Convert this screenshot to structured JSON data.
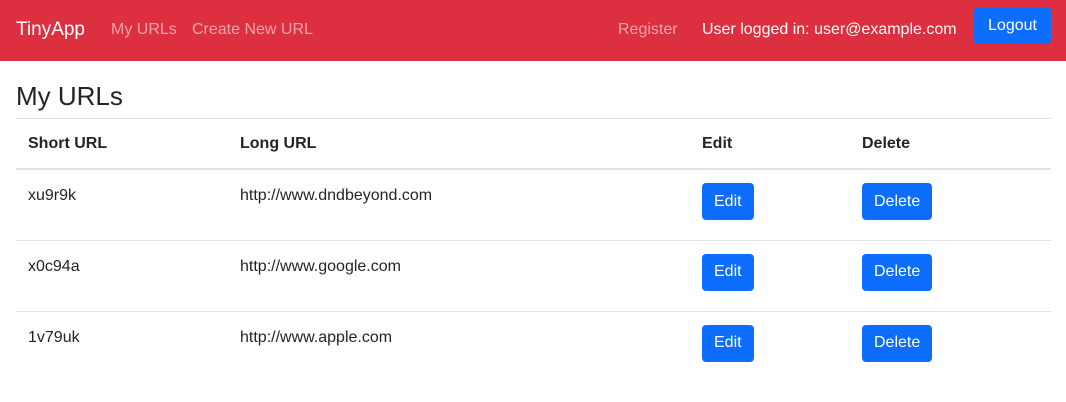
{
  "navbar": {
    "brand": "TinyApp",
    "links": {
      "my_urls": "My URLs",
      "create_new_url": "Create New URL",
      "register": "Register"
    },
    "logged_in_text": "User logged in: user@example.com",
    "logout_label": "Logout",
    "colors": {
      "navbar_bg": "#dc3040",
      "button_primary": "#0d6efd"
    }
  },
  "main": {
    "title": "My URLs",
    "table": {
      "headers": [
        "Short URL",
        "Long URL",
        "Edit",
        "Delete"
      ],
      "rows": [
        {
          "short": "xu9r9k",
          "long": "http://www.dndbeyond.com",
          "edit": "Edit",
          "delete": "Delete"
        },
        {
          "short": "x0c94a",
          "long": "http://www.google.com",
          "edit": "Edit",
          "delete": "Delete"
        },
        {
          "short": "1v79uk",
          "long": "http://www.apple.com",
          "edit": "Edit",
          "delete": "Delete"
        }
      ]
    }
  }
}
